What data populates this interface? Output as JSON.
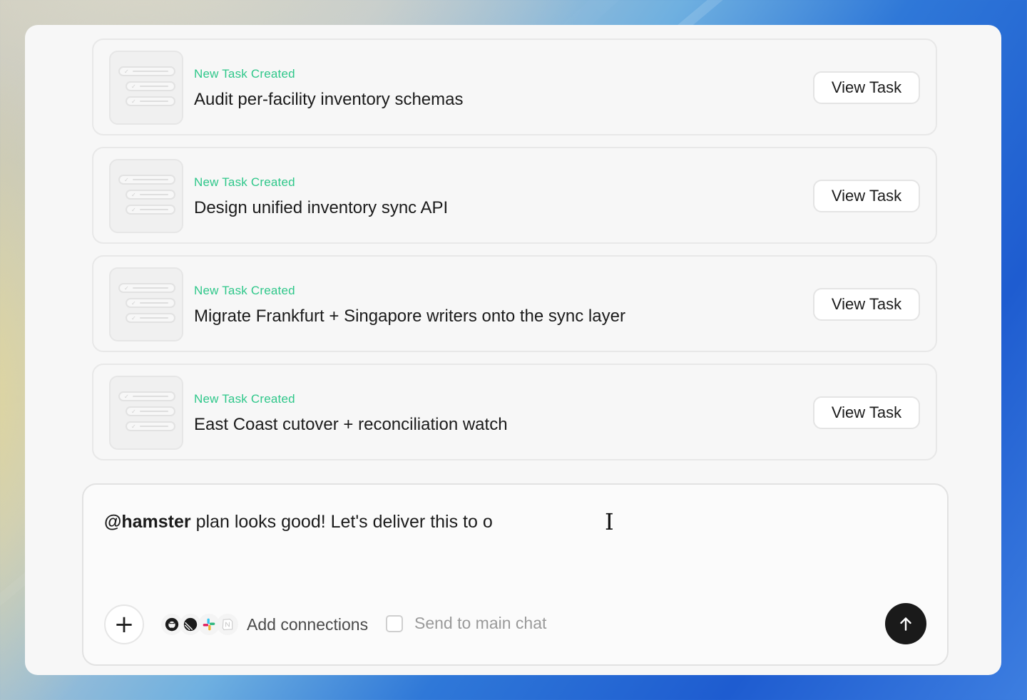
{
  "tasks": [
    {
      "kicker": "New Task Created",
      "title": "Audit per-facility inventory schemas",
      "button": "View Task"
    },
    {
      "kicker": "New Task Created",
      "title": "Design unified inventory sync API",
      "button": "View Task"
    },
    {
      "kicker": "New Task Created",
      "title": "Migrate Frankfurt + Singapore writers onto the sync layer",
      "button": "View Task"
    },
    {
      "kicker": "New Task Created",
      "title": "East Coast cutover + reconciliation watch",
      "button": "View Task"
    }
  ],
  "composer": {
    "mention": "@hamster",
    "text": " plan looks good! Let's deliver this to o",
    "add_connections_label": "Add connections",
    "send_to_main_chat_label": "Send to main chat",
    "send_to_main_chat_checked": false,
    "connection_icons": [
      "github-icon",
      "linear-icon",
      "slack-icon",
      "notion-icon"
    ]
  },
  "colors": {
    "kicker": "#2fc78a",
    "send_button": "#1a1a1a"
  }
}
